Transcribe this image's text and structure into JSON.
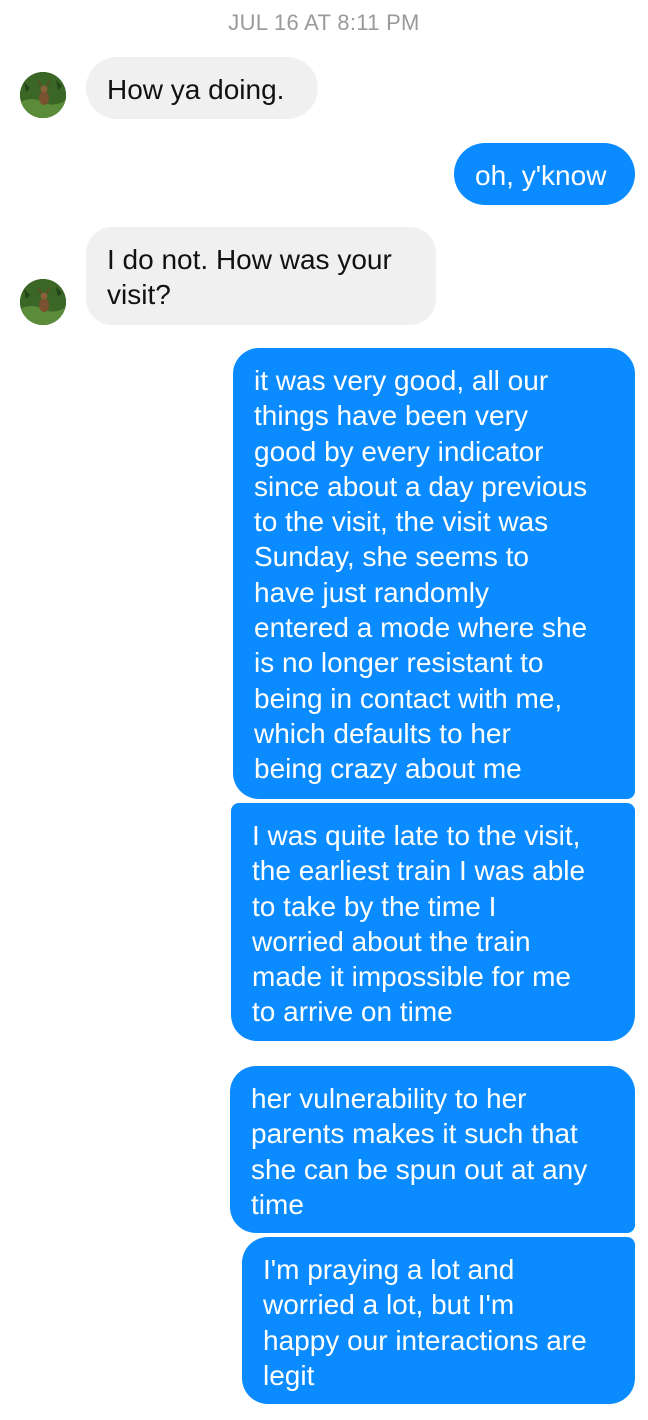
{
  "conversation": {
    "timestamp": "JUL 16 AT 8:11 PM",
    "colors": {
      "incoming_bubble": "#f0f0f0",
      "outgoing_bubble": "#0a8bff",
      "timestamp_text": "#9a9a9a"
    },
    "avatar_icon": "contact-photo-deer-in-grass",
    "messages": [
      {
        "direction": "incoming",
        "lines": [
          "How ya doing."
        ]
      },
      {
        "direction": "outgoing",
        "lines": [
          "oh, y'know"
        ]
      },
      {
        "direction": "incoming",
        "lines": [
          "I do not. How was your",
          "visit?"
        ]
      },
      {
        "direction": "outgoing",
        "lines": [
          "it was very good, all our",
          "things have been very",
          "good by every indicator",
          "since about a day previous",
          "to the visit, the visit was",
          "Sunday, she seems to",
          "have just randomly",
          "entered a mode where she",
          "is no longer resistant to",
          "being in contact with me,",
          "which defaults to her",
          "being crazy about me"
        ]
      },
      {
        "direction": "outgoing",
        "lines": [
          "I was quite late to the visit,",
          "the earliest train I was able",
          "to take by the time I",
          "worried about the train",
          "made it impossible for me",
          "to arrive on time"
        ]
      },
      {
        "direction": "outgoing",
        "lines": [
          "her vulnerability to her",
          "parents makes it such that",
          "she can be spun out at any",
          "time"
        ]
      },
      {
        "direction": "outgoing",
        "lines": [
          "I'm praying a lot and",
          "worried a lot, but I'm",
          "happy our interactions are",
          "legit"
        ]
      }
    ]
  }
}
